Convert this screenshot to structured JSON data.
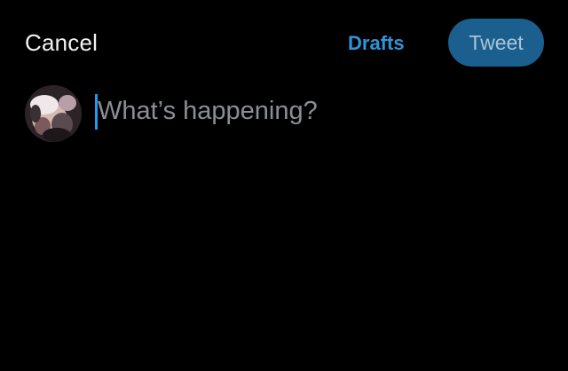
{
  "header": {
    "cancel_label": "Cancel",
    "drafts_label": "Drafts",
    "tweet_label": "Tweet"
  },
  "compose": {
    "value": "",
    "placeholder": "What’s happening?"
  },
  "colors": {
    "background": "#000000",
    "accent_blue": "#2f95d8",
    "tweet_button_bg": "#1b5f8e",
    "tweet_button_text": "#a9c4d8",
    "placeholder_text": "#8a8f94",
    "caret": "#1d9bf0"
  },
  "icons": {
    "avatar": "profile-avatar"
  }
}
